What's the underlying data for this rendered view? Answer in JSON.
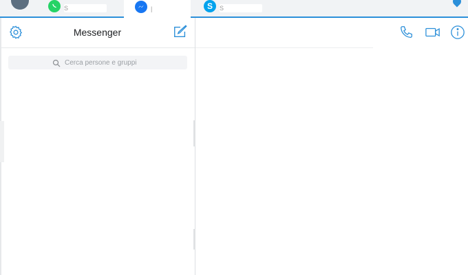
{
  "tabs": [
    {
      "name": "WhatsApp",
      "label": "S",
      "active": false
    },
    {
      "name": "Messenger",
      "label": "|",
      "active": true
    },
    {
      "name": "Skype",
      "label": "S",
      "active": false
    }
  ],
  "sidebar": {
    "title": "Messenger",
    "search": {
      "placeholder": "Cerca persone e gruppi",
      "value": ""
    }
  },
  "colors": {
    "accent": "#2b8fd9",
    "messenger": "#1877f2",
    "whatsapp": "#25d366",
    "skype": "#00a2ed"
  },
  "icons": [
    "app-avatar",
    "whatsapp-icon",
    "messenger-icon",
    "skype-icon",
    "pin-icon",
    "gear-icon",
    "compose-icon",
    "search-icon",
    "phone-icon",
    "video-camera-icon",
    "info-icon"
  ]
}
